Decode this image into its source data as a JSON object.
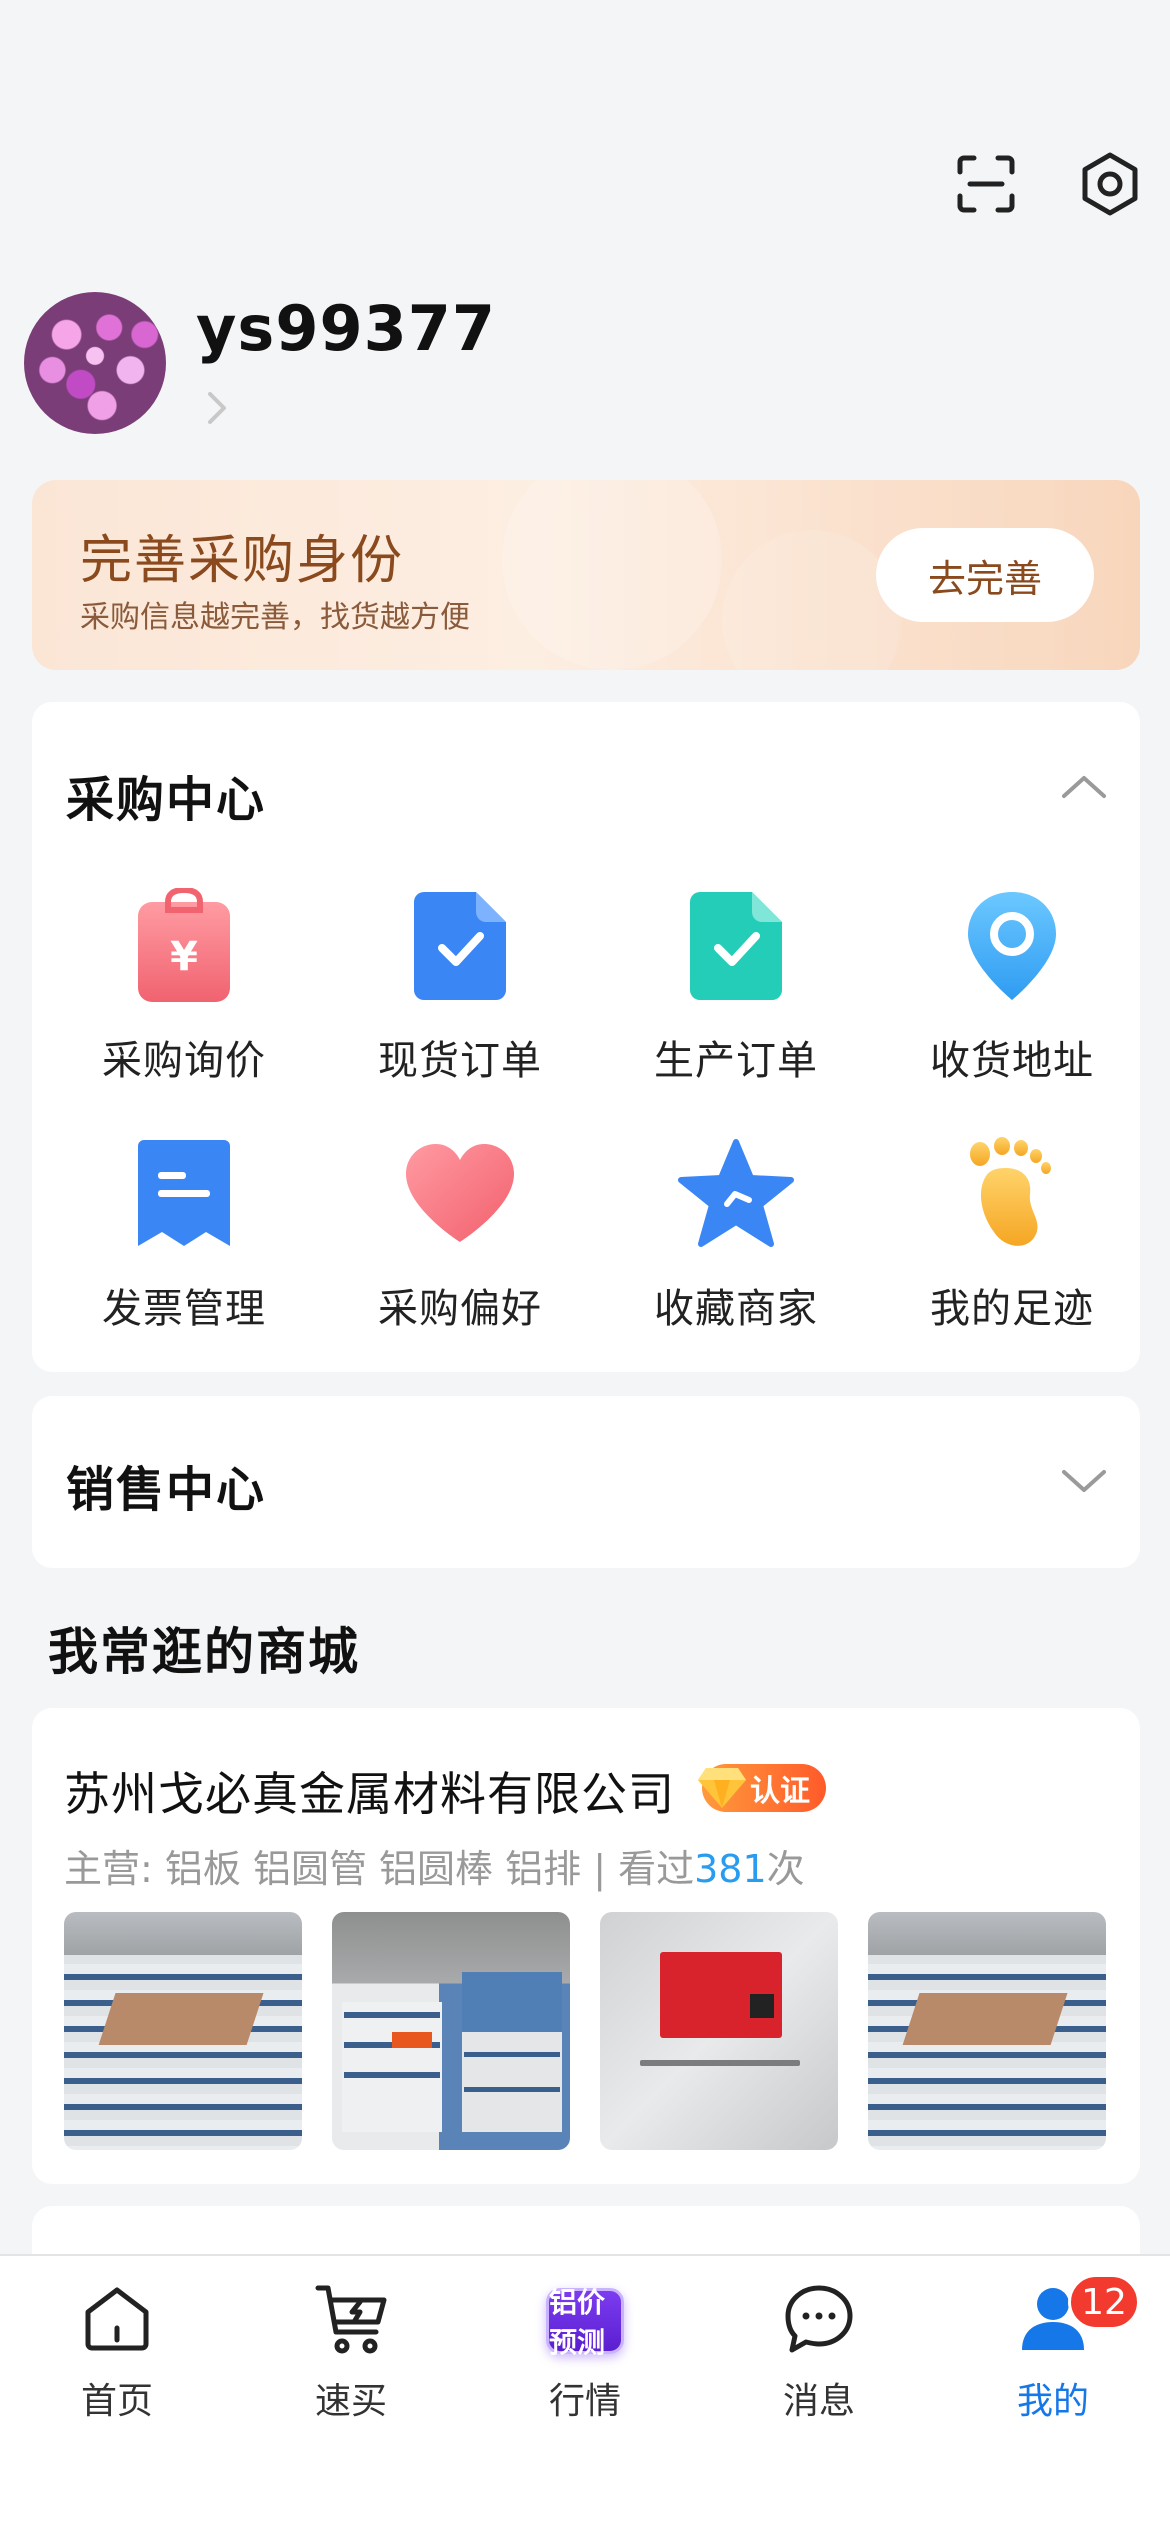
{
  "profile": {
    "username": "ys99377"
  },
  "banner": {
    "title": "完善采购身份",
    "subtitle": "采购信息越完善，找货越方便",
    "button": "去完善"
  },
  "purchase_center": {
    "title": "采购中心",
    "items": [
      {
        "label": "采购询价",
        "icon": "purchase-inquiry-icon"
      },
      {
        "label": "现货订单",
        "icon": "spot-order-icon"
      },
      {
        "label": "生产订单",
        "icon": "production-order-icon"
      },
      {
        "label": "收货地址",
        "icon": "location-pin-icon"
      },
      {
        "label": "发票管理",
        "icon": "invoice-icon"
      },
      {
        "label": "采购偏好",
        "icon": "heart-icon"
      },
      {
        "label": "收藏商家",
        "icon": "star-icon"
      },
      {
        "label": "我的足迹",
        "icon": "footprint-icon"
      }
    ]
  },
  "sales_center": {
    "title": "销售中心"
  },
  "frequent_malls": {
    "heading": "我常逛的商城",
    "shops": [
      {
        "name": "苏州戈必真金属材料有限公司",
        "badge": "认证",
        "meta_prefix": "主营: 铝板 铝圆管 铝圆棒 铝排  |  看过",
        "visit_count": "381",
        "meta_suffix": "次"
      }
    ]
  },
  "tabbar": {
    "items": [
      {
        "label": "首页",
        "icon": "home-icon"
      },
      {
        "label": "速买",
        "icon": "cart-icon"
      },
      {
        "label": "行情",
        "promo": "铝价预测"
      },
      {
        "label": "消息",
        "icon": "chat-icon"
      },
      {
        "label": "我的",
        "icon": "user-icon",
        "badge": "12"
      }
    ],
    "active_color": "#1677e8"
  }
}
